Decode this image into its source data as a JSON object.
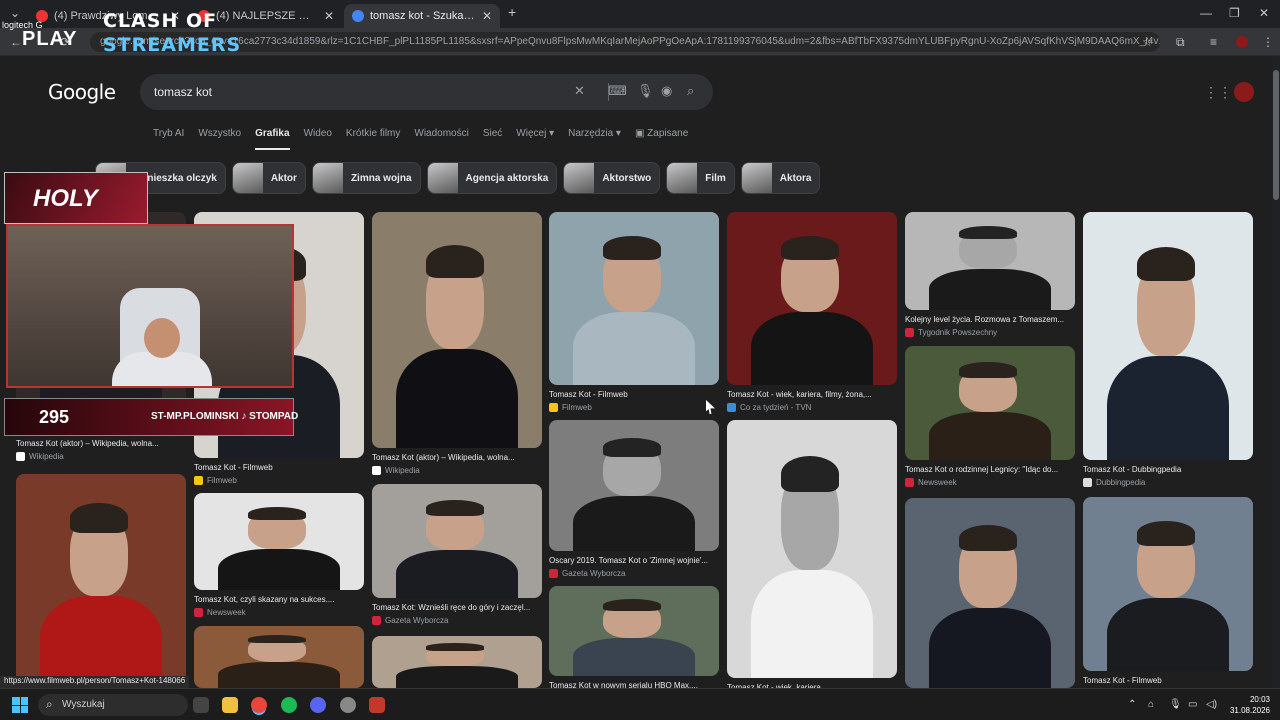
{
  "browser": {
    "tabs": [
      {
        "label": "(4) Prawdziwy Lombard - Od..",
        "favicon_color": "#e33"
      },
      {
        "label": "(4) NAJLEPSZE MOMENTY POL..",
        "favicon_color": "#e33"
      },
      {
        "label": "tomasz kot - Szukaj w Google",
        "favicon_color": "#4285f4",
        "active": true
      }
    ],
    "new_tab": "+",
    "url": "google.com/search?sca_esv=16ca2773c34d1859&rlz=1C1CHBF_plPL1185PL1185&sxsrf=APpeQnvu8FlpsMwMKqIarMejAoPPgOeApA:1781199376045&udm=2&fbs=ABfTbFX9375dmYLUBFpyRgnU-XoZp6jAVSqfKhVSjM9DAAQ6mX_I4v10V3NI_RDC8c..."
  },
  "google": {
    "logo": "Google",
    "query": "tomasz kot",
    "nav": [
      "Tryb AI",
      "Wszystko",
      "Grafika",
      "Wideo",
      "Krótkie filmy",
      "Wiadomości",
      "Sieć",
      "Więcej ▾",
      "Narzędzia ▾",
      "▣ Zapisane"
    ],
    "nav_active": "Grafika",
    "chips": [
      "Agnieszka olczyk",
      "Aktor",
      "Zimna wojna",
      "Agencja aktorska",
      "Aktorstwo",
      "Film",
      "Aktora"
    ]
  },
  "results": [
    {
      "caption": "Tomasz Kot (aktor) – Wikipedia, wolna...",
      "source": "Wikipedia",
      "src_color": "#ffffff"
    },
    {
      "caption": "Tomasz Kot - Filmweb",
      "source": "Filmweb",
      "src_color": "#f5c518"
    },
    {
      "caption": "Tomasz Kot (aktor) – Wikipedia, wolna...",
      "source": "Wikipedia",
      "src_color": "#ffffff"
    },
    {
      "caption": "Tomasz Kot - Filmweb",
      "source": "Filmweb",
      "src_color": "#f5c518"
    },
    {
      "caption": "Tomasz Kot - wiek, kariera, filmy, żona,...",
      "source": "Co za tydzień - TVN",
      "src_color": "#3a8fd6"
    },
    {
      "caption": "Kolejny level życia. Rozmowa z Tomaszem...",
      "source": "Tygodnik Powszechny",
      "src_color": "#d0233c"
    },
    {
      "caption": "Tomasz Kot - Dubbingpedia",
      "source": "Dubbingpedia",
      "src_color": "#dddddd"
    },
    {
      "caption": "Tomasz Kot o rodzinnej Legnicy: \"Idąc do...",
      "source": "Newsweek",
      "src_color": "#d0233c"
    },
    {
      "caption": "Oscary 2019. Tomasz Kot o 'Zimnej wojnie'...",
      "source": "Gazeta Wyborcza",
      "src_color": "#d0233c"
    },
    {
      "caption": "Tomasz Kot, czyli skazany na sukces....",
      "source": "Newsweek",
      "src_color": "#d0233c"
    },
    {
      "caption": "Tomasz Kot: Wznieśli ręce do góry i zaczęl...",
      "source": "Gazeta Wyborcza",
      "src_color": "#d0233c"
    },
    {
      "caption": "Tomasz Kot w nowym serialu HBO Max....",
      "source": "",
      "src_color": "#888888"
    },
    {
      "caption": "Tomasz Kot - Filmweb",
      "source": "",
      "src_color": "#f5c518"
    },
    {
      "caption": "Tomasz Kot - wiek, kariera...",
      "source": "",
      "src_color": "#888888"
    }
  ],
  "overlay": {
    "logitech": "logitech G",
    "play": "PLAY",
    "clash": "CLASH OF",
    "streamers": "STREAMERS",
    "holy": "HOLY",
    "viewer_count": "295",
    "handles": "ST-MP.PLOMINSKI  ♪ STOMPAD"
  },
  "status_url": "https://www.filmweb.pl/person/Tomasz+Kot-148066",
  "taskbar": {
    "search_placeholder": "Wyszukaj",
    "time": "20:03",
    "date": "31.08.2026"
  }
}
